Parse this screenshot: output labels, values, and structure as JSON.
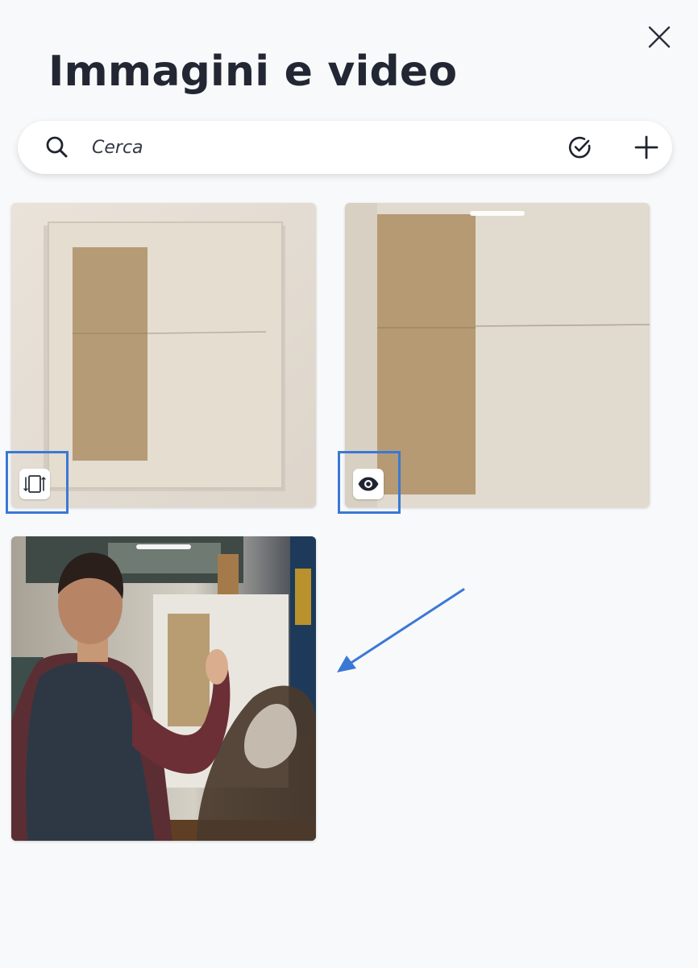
{
  "panel": {
    "title": "Immagini e video",
    "close_icon": "close-icon"
  },
  "search": {
    "placeholder": "Cerca",
    "value": "",
    "icon": "search-icon",
    "select_icon": "check-circle-icon",
    "add_icon": "plus-icon"
  },
  "media": [
    {
      "badge_icon": "animation-icon",
      "has_drag_handle": false
    },
    {
      "badge_icon": "eye-icon",
      "has_drag_handle": true
    },
    {
      "badge_icon": "",
      "has_drag_handle": true
    }
  ],
  "annotation": {
    "highlight_color": "#3a78d6",
    "arrow_color": "#3a78d6"
  }
}
